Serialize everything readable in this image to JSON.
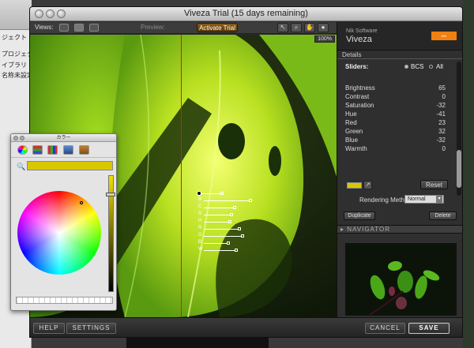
{
  "background_app": {
    "items": [
      "ジェクト",
      "プロジェクト",
      "イブラリ",
      "名称未設定プロ"
    ]
  },
  "window": {
    "title": "Viveza Trial (15 days remaining)"
  },
  "toolbar": {
    "views_label": "Views:",
    "preview_label": "Preview:",
    "activate_label": "Activate Trial",
    "zoom_label": "100%"
  },
  "control_points": {
    "labels": [
      "B",
      "C",
      "S",
      "H",
      "R",
      "G",
      "B",
      "W"
    ]
  },
  "panel": {
    "brand_top": "Nik Software",
    "brand_name": "Viveza",
    "details_label": "Details",
    "sliders_label": "Sliders:",
    "radio_bcs": "BCS",
    "radio_all": "All",
    "params": [
      {
        "name": "Brightness",
        "value": "65"
      },
      {
        "name": "Contrast",
        "value": "0"
      },
      {
        "name": "Saturation",
        "value": "-32"
      },
      {
        "name": "Hue",
        "value": "-41"
      },
      {
        "name": "Red",
        "value": "23"
      },
      {
        "name": "Green",
        "value": "32"
      },
      {
        "name": "Blue",
        "value": "-32"
      },
      {
        "name": "Warmth",
        "value": "0"
      }
    ],
    "reset_label": "Reset",
    "rendering_label": "Rendering Method",
    "rendering_value": "Normal",
    "duplicate_label": "Duplicate",
    "delete_label": "Delete",
    "navigator_label": "NAVIGATOR"
  },
  "bottombar": {
    "help_label": "HELP",
    "settings_label": "SETTINGS",
    "cancel_label": "CANCEL",
    "save_label": "SAVE"
  },
  "palette": {
    "title": "カラー",
    "selected_color": "#d8c800"
  }
}
